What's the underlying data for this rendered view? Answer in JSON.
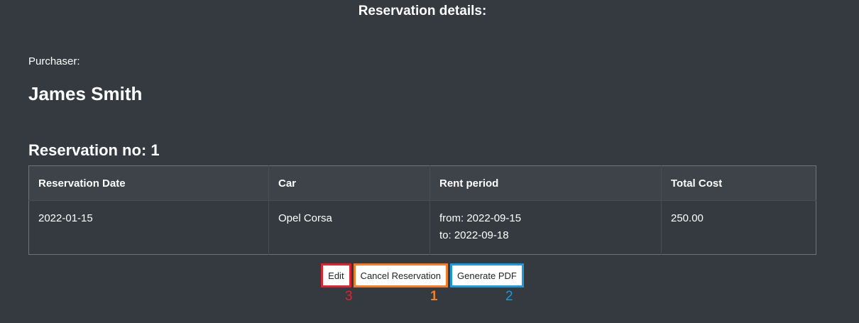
{
  "page": {
    "title": "Reservation details:"
  },
  "purchaser": {
    "label": "Purchaser:",
    "name": "James Smith"
  },
  "reservation": {
    "heading": "Reservation no: 1",
    "table": {
      "headers": [
        "Reservation Date",
        "Car",
        "Rent period",
        "Total Cost"
      ],
      "row": {
        "date": "2022-01-15",
        "car": "Opel Corsa",
        "period_from": "from: 2022-09-15",
        "period_to": "to: 2022-09-18",
        "total_cost": "250.00"
      }
    }
  },
  "actions": {
    "edit_label": "Edit",
    "cancel_label": "Cancel Reservation",
    "pdf_label": "Generate PDF"
  },
  "annotations": {
    "edit_marker": "3",
    "cancel_marker": "1",
    "pdf_marker": "2",
    "colors": {
      "edit": "#d92632",
      "cancel": "#ef7d2a",
      "pdf": "#1a9ad6"
    }
  },
  "colors": {
    "background": "#343a40",
    "table_header_bg": "#3d4349",
    "text": "#ffffff"
  }
}
